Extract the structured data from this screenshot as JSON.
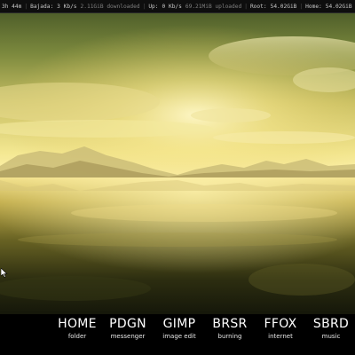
{
  "statusbar": {
    "uptime": "3h 44m",
    "down_label": "Bajada:",
    "down_rate": "3 Kb/s",
    "downloaded": "2.11GiB downloaded",
    "up_label": "Up:",
    "up_rate": "0 Kb/s",
    "uploaded": "69.21MiB uploaded",
    "root_label": "Root:",
    "root_value": "54.02GiB",
    "home_label": "Home:",
    "home_value": "54.02GiB"
  },
  "wallpaper": {
    "description_icon": "sunset-lake-wallpaper"
  },
  "dock": {
    "items": [
      {
        "code": "HOME",
        "desc": "folder"
      },
      {
        "code": "PDGN",
        "desc": "messenger"
      },
      {
        "code": "GIMP",
        "desc": "image edit"
      },
      {
        "code": "BRSR",
        "desc": "burning"
      },
      {
        "code": "FFOX",
        "desc": "internet"
      },
      {
        "code": "SBRD",
        "desc": "music"
      }
    ]
  },
  "colors": {
    "sky_top": "#5a6a2e",
    "sun_glow": "#fff6b0",
    "water_dark": "#1a1d0c",
    "dock_bg": "#000000",
    "text": "#ffffff"
  }
}
